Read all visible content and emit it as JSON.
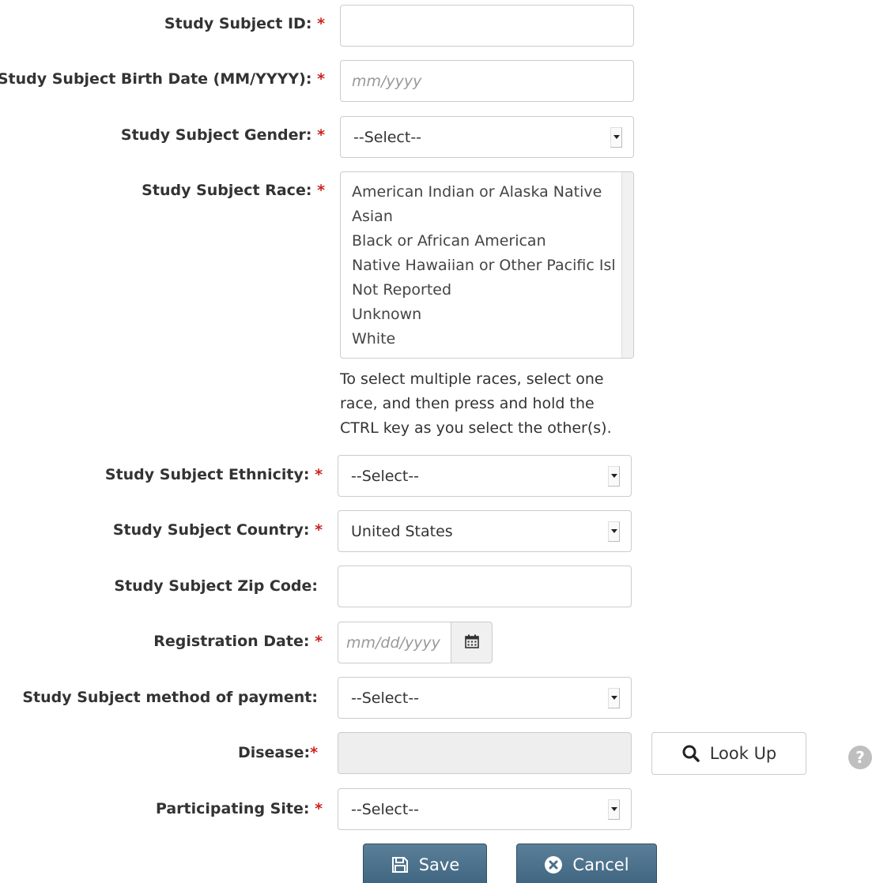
{
  "form": {
    "subject_id": {
      "label": "Study Subject ID:",
      "required": "*",
      "value": "",
      "placeholder": ""
    },
    "birth_date": {
      "label": "Study Subject Birth Date (MM/YYYY):",
      "required": "*",
      "value": "",
      "placeholder": "mm/yyyy"
    },
    "gender": {
      "label": "Study Subject Gender:",
      "required": "*",
      "selected": "--Select--"
    },
    "race": {
      "label": "Study Subject Race:",
      "required": "*",
      "options": [
        "American Indian or Alaska Native",
        "Asian",
        "Black or African American",
        "Native Hawaiian or Other Pacific Isl",
        "Not Reported",
        "Unknown",
        "White"
      ],
      "help_lines": [
        "To select multiple races, select one",
        "race, and then press and hold the",
        "CTRL key as you select the other(s)."
      ]
    },
    "ethnicity": {
      "label": "Study Subject Ethnicity:",
      "required": "*",
      "selected": "--Select--"
    },
    "country": {
      "label": "Study Subject Country:",
      "required": "*",
      "selected": "United States"
    },
    "zip": {
      "label": "Study Subject Zip Code:",
      "value": "",
      "placeholder": ""
    },
    "registration_date": {
      "label": "Registration Date:",
      "required": "*",
      "value": "",
      "placeholder": "mm/dd/yyyy"
    },
    "payment": {
      "label": "Study Subject method of payment:",
      "selected": "--Select--"
    },
    "disease": {
      "label": "Disease:",
      "required": "*",
      "value": "",
      "lookup_label": "Look Up",
      "help_glyph": "?"
    },
    "site": {
      "label": "Participating Site:",
      "required": "*",
      "selected": "--Select--"
    }
  },
  "actions": {
    "save_label": "Save",
    "cancel_label": "Cancel"
  },
  "colors": {
    "required": "#cc2222",
    "button_dark": "#4a6f8a",
    "disabled_field": "#eeeeee"
  }
}
